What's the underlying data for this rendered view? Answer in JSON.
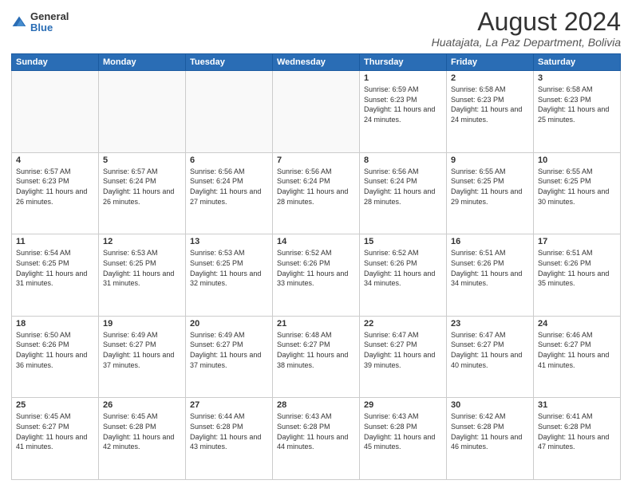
{
  "logo": {
    "general": "General",
    "blue": "Blue"
  },
  "header": {
    "month": "August 2024",
    "location": "Huatajata, La Paz Department, Bolivia"
  },
  "days_of_week": [
    "Sunday",
    "Monday",
    "Tuesday",
    "Wednesday",
    "Thursday",
    "Friday",
    "Saturday"
  ],
  "weeks": [
    [
      {
        "day": "",
        "info": ""
      },
      {
        "day": "",
        "info": ""
      },
      {
        "day": "",
        "info": ""
      },
      {
        "day": "",
        "info": ""
      },
      {
        "day": "1",
        "info": "Sunrise: 6:59 AM\nSunset: 6:23 PM\nDaylight: 11 hours and 24 minutes."
      },
      {
        "day": "2",
        "info": "Sunrise: 6:58 AM\nSunset: 6:23 PM\nDaylight: 11 hours and 24 minutes."
      },
      {
        "day": "3",
        "info": "Sunrise: 6:58 AM\nSunset: 6:23 PM\nDaylight: 11 hours and 25 minutes."
      }
    ],
    [
      {
        "day": "4",
        "info": "Sunrise: 6:57 AM\nSunset: 6:23 PM\nDaylight: 11 hours and 26 minutes."
      },
      {
        "day": "5",
        "info": "Sunrise: 6:57 AM\nSunset: 6:24 PM\nDaylight: 11 hours and 26 minutes."
      },
      {
        "day": "6",
        "info": "Sunrise: 6:56 AM\nSunset: 6:24 PM\nDaylight: 11 hours and 27 minutes."
      },
      {
        "day": "7",
        "info": "Sunrise: 6:56 AM\nSunset: 6:24 PM\nDaylight: 11 hours and 28 minutes."
      },
      {
        "day": "8",
        "info": "Sunrise: 6:56 AM\nSunset: 6:24 PM\nDaylight: 11 hours and 28 minutes."
      },
      {
        "day": "9",
        "info": "Sunrise: 6:55 AM\nSunset: 6:25 PM\nDaylight: 11 hours and 29 minutes."
      },
      {
        "day": "10",
        "info": "Sunrise: 6:55 AM\nSunset: 6:25 PM\nDaylight: 11 hours and 30 minutes."
      }
    ],
    [
      {
        "day": "11",
        "info": "Sunrise: 6:54 AM\nSunset: 6:25 PM\nDaylight: 11 hours and 31 minutes."
      },
      {
        "day": "12",
        "info": "Sunrise: 6:53 AM\nSunset: 6:25 PM\nDaylight: 11 hours and 31 minutes."
      },
      {
        "day": "13",
        "info": "Sunrise: 6:53 AM\nSunset: 6:25 PM\nDaylight: 11 hours and 32 minutes."
      },
      {
        "day": "14",
        "info": "Sunrise: 6:52 AM\nSunset: 6:26 PM\nDaylight: 11 hours and 33 minutes."
      },
      {
        "day": "15",
        "info": "Sunrise: 6:52 AM\nSunset: 6:26 PM\nDaylight: 11 hours and 34 minutes."
      },
      {
        "day": "16",
        "info": "Sunrise: 6:51 AM\nSunset: 6:26 PM\nDaylight: 11 hours and 34 minutes."
      },
      {
        "day": "17",
        "info": "Sunrise: 6:51 AM\nSunset: 6:26 PM\nDaylight: 11 hours and 35 minutes."
      }
    ],
    [
      {
        "day": "18",
        "info": "Sunrise: 6:50 AM\nSunset: 6:26 PM\nDaylight: 11 hours and 36 minutes."
      },
      {
        "day": "19",
        "info": "Sunrise: 6:49 AM\nSunset: 6:27 PM\nDaylight: 11 hours and 37 minutes."
      },
      {
        "day": "20",
        "info": "Sunrise: 6:49 AM\nSunset: 6:27 PM\nDaylight: 11 hours and 37 minutes."
      },
      {
        "day": "21",
        "info": "Sunrise: 6:48 AM\nSunset: 6:27 PM\nDaylight: 11 hours and 38 minutes."
      },
      {
        "day": "22",
        "info": "Sunrise: 6:47 AM\nSunset: 6:27 PM\nDaylight: 11 hours and 39 minutes."
      },
      {
        "day": "23",
        "info": "Sunrise: 6:47 AM\nSunset: 6:27 PM\nDaylight: 11 hours and 40 minutes."
      },
      {
        "day": "24",
        "info": "Sunrise: 6:46 AM\nSunset: 6:27 PM\nDaylight: 11 hours and 41 minutes."
      }
    ],
    [
      {
        "day": "25",
        "info": "Sunrise: 6:45 AM\nSunset: 6:27 PM\nDaylight: 11 hours and 41 minutes."
      },
      {
        "day": "26",
        "info": "Sunrise: 6:45 AM\nSunset: 6:28 PM\nDaylight: 11 hours and 42 minutes."
      },
      {
        "day": "27",
        "info": "Sunrise: 6:44 AM\nSunset: 6:28 PM\nDaylight: 11 hours and 43 minutes."
      },
      {
        "day": "28",
        "info": "Sunrise: 6:43 AM\nSunset: 6:28 PM\nDaylight: 11 hours and 44 minutes."
      },
      {
        "day": "29",
        "info": "Sunrise: 6:43 AM\nSunset: 6:28 PM\nDaylight: 11 hours and 45 minutes."
      },
      {
        "day": "30",
        "info": "Sunrise: 6:42 AM\nSunset: 6:28 PM\nDaylight: 11 hours and 46 minutes."
      },
      {
        "day": "31",
        "info": "Sunrise: 6:41 AM\nSunset: 6:28 PM\nDaylight: 11 hours and 47 minutes."
      }
    ]
  ]
}
